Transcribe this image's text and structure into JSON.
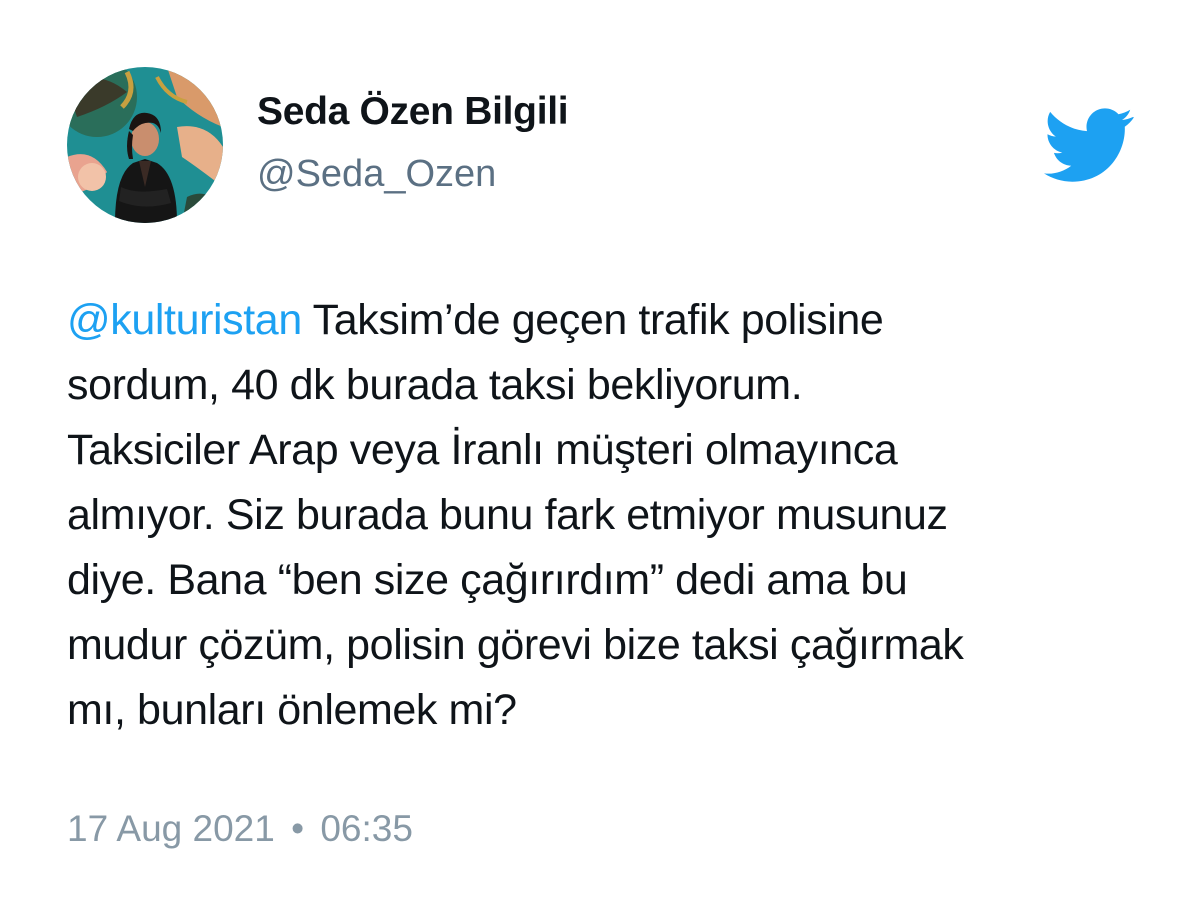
{
  "author": {
    "display_name": "Seda Özen Bilgili",
    "handle": "@Seda_Ozen"
  },
  "brand": {
    "icon": "twitter-bird-icon",
    "color": "#1da1f2"
  },
  "tweet": {
    "mention": "@kulturistan",
    "lines": [
      " Taksim’de geçen trafik polisine",
      "sordum, 40 dk burada taksi bekliyorum.",
      "Taksiciler Arap veya İranlı müşteri olmayınca",
      "almıyor. Siz burada bunu fark etmiyor musunuz",
      "diye. Bana “ben size çağırırdım” dedi ama bu",
      "mudur çözüm, polisin görevi bize taksi çağırmak",
      "mı, bunları önlemek mi?"
    ]
  },
  "meta": {
    "date": "17 Aug 2021",
    "separator": "•",
    "time": "06:35"
  }
}
